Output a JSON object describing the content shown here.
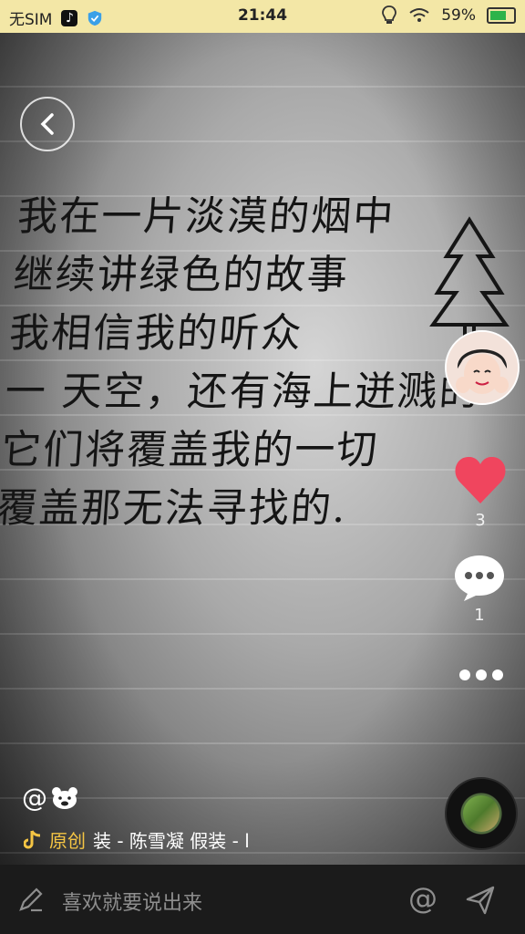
{
  "status_bar": {
    "carrier": "无SIM",
    "time": "21:44",
    "battery": "59%",
    "battery_level": 0.59
  },
  "video": {
    "handwritten_lines": [
      "我在一片淡漠的烟中",
      "继续讲绿色的故事",
      "我相信我的听众",
      "一 天空，还有海上迸溅的",
      "它们将覆盖我的一切",
      "覆盖那无法寻找的."
    ]
  },
  "actions": {
    "like_count": "3",
    "comment_count": "1",
    "accent_like": "#f0455e"
  },
  "author": {
    "username": "@"
  },
  "music": {
    "original_tag": "原创",
    "title": "装 - 陈雪凝    假装 - l"
  },
  "comment_bar": {
    "placeholder": "喜欢就要说出来",
    "at_symbol": "@"
  }
}
